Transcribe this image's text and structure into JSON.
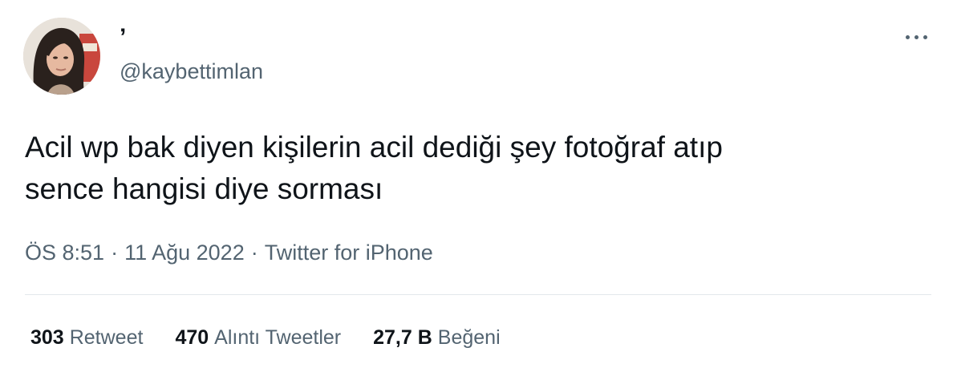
{
  "author": {
    "display_name": "’",
    "handle": "@kaybettimlan",
    "avatar_icon": "profile-photo"
  },
  "menu_icon": "more-horizontal-icon",
  "tweet": {
    "text_lines": [
      "Acil wp bak diyen kişilerin acil dediği şey fotoğraf atıp",
      "sence hangisi diye sorması"
    ]
  },
  "meta": {
    "time": "ÖS 8:51",
    "separator": "·",
    "date": "11 Ağu 2022",
    "source": "Twitter for iPhone"
  },
  "stats": [
    {
      "count": "303",
      "label": "Retweet"
    },
    {
      "count": "470",
      "label": "Alıntı Tweetler"
    },
    {
      "count": "27,7 B",
      "label": "Beğeni"
    }
  ],
  "colors": {
    "text_primary": "#0f1419",
    "text_secondary": "#536471",
    "divider": "#e3e8ec",
    "background": "#ffffff"
  }
}
